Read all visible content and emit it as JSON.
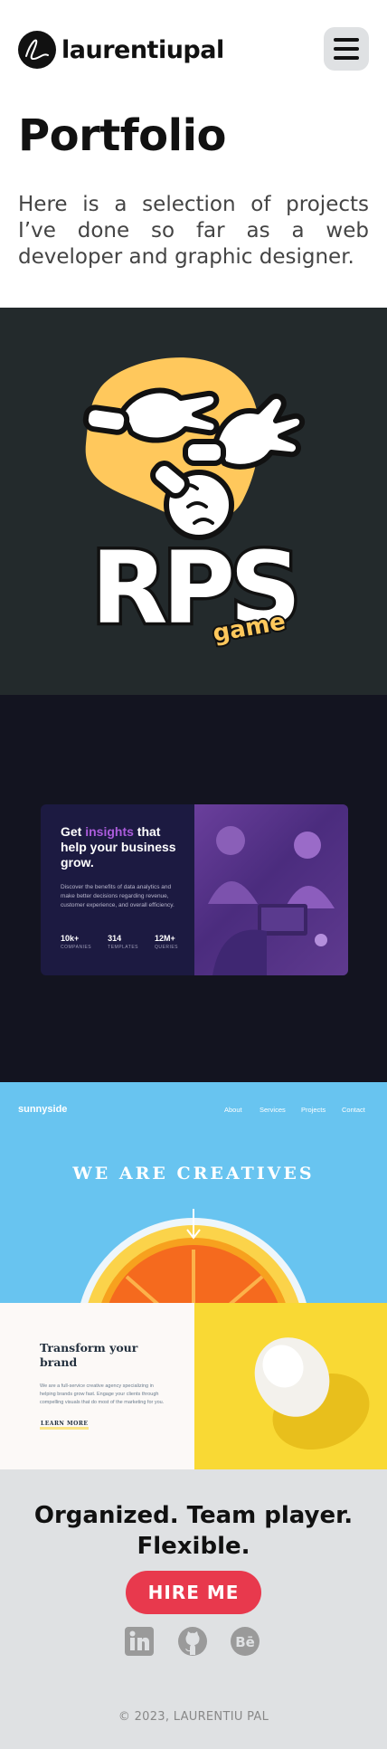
{
  "header": {
    "logo_text": "laurentiupal",
    "logo_mark": "Lau"
  },
  "intro": {
    "title": "Portfolio",
    "description": "Here is a selection of projects I’ve done so far as a web developer and graphic designer."
  },
  "projects": {
    "rps": {
      "logo_text": "RPS",
      "logo_sub": "game"
    },
    "insights": {
      "head_before": "Get ",
      "head_accent": "insights",
      "head_after": " that help your business grow.",
      "description": "Discover the benefits of data analytics and make better decisions regarding revenue, customer experience, and overall efficiency.",
      "stats": [
        {
          "value": "10k+",
          "label": "COMPANIES"
        },
        {
          "value": "314",
          "label": "TEMPLATES"
        },
        {
          "value": "12M+",
          "label": "QUERIES"
        }
      ]
    },
    "sunnyside": {
      "brand": "sunnyside",
      "nav": [
        "About",
        "Services",
        "Projects",
        "Contact"
      ],
      "hero": "WE ARE CREATIVES",
      "feature_title": "Transform your brand",
      "feature_text": "We are a full-service creative agency specializing in helping brands grow fast. Engage your clients through compelling visuals that do most of the marketing for you.",
      "feature_link": "LEARN MORE"
    }
  },
  "footer": {
    "tagline": "Organized. Team player. Flexible.",
    "cta": "HIRE ME",
    "copyright": "© 2023, LAURENTIU PAL",
    "social_icons": [
      "linkedin-icon",
      "github-icon",
      "behance-icon"
    ]
  },
  "colors": {
    "accent": "#e8394d",
    "footer_bg": "#dfe1e3",
    "rps_bg": "#232a2c",
    "insights_bg": "#131420",
    "sunny_sky": "#68c4f0"
  }
}
